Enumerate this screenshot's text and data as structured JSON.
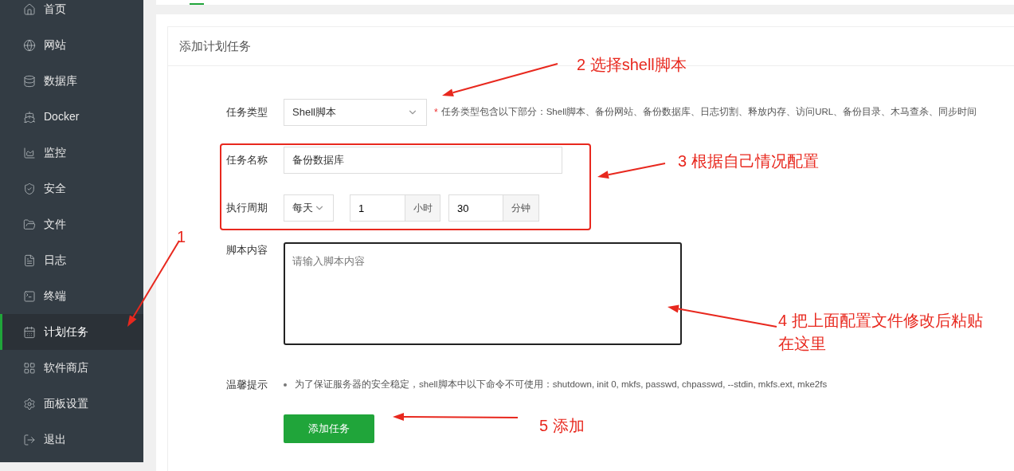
{
  "sidebar": {
    "items": [
      {
        "label": "首页",
        "selected": false
      },
      {
        "label": "网站",
        "selected": false
      },
      {
        "label": "数据库",
        "selected": false
      },
      {
        "label": "Docker",
        "selected": false
      },
      {
        "label": "监控",
        "selected": false
      },
      {
        "label": "安全",
        "selected": false
      },
      {
        "label": "文件",
        "selected": false
      },
      {
        "label": "日志",
        "selected": false
      },
      {
        "label": "终端",
        "selected": false
      },
      {
        "label": "计划任务",
        "selected": true
      },
      {
        "label": "软件商店",
        "selected": false
      },
      {
        "label": "面板设置",
        "selected": false
      },
      {
        "label": "退出",
        "selected": false
      }
    ]
  },
  "panel": {
    "title": "添加计划任务",
    "task_type": {
      "label": "任务类型",
      "value": "Shell脚本",
      "required_mark": "*",
      "note": "任务类型包含以下部分：Shell脚本、备份网站、备份数据库、日志切割、释放内存、访问URL、备份目录、木马查杀、同步时间"
    },
    "task_name": {
      "label": "任务名称",
      "value": "备份数据库"
    },
    "period": {
      "label": "执行周期",
      "frequency": "每天",
      "hours": "1",
      "hours_unit": "小时",
      "minutes": "30",
      "minutes_unit": "分钟"
    },
    "script": {
      "label": "脚本内容",
      "placeholder": "请输入脚本内容"
    },
    "tip": {
      "label": "温馨提示",
      "text": "为了保证服务器的安全稳定，shell脚本中以下命令不可使用：shutdown, init 0, mkfs, passwd, chpasswd, --stdin, mkfs.ext, mke2fs"
    },
    "submit": "添加任务"
  },
  "annotations": [
    "1",
    "2 选择shell脚本",
    "3 根据自己情况配置",
    "4 把上面配置文件修改后粘贴在这里",
    "5 添加"
  ]
}
